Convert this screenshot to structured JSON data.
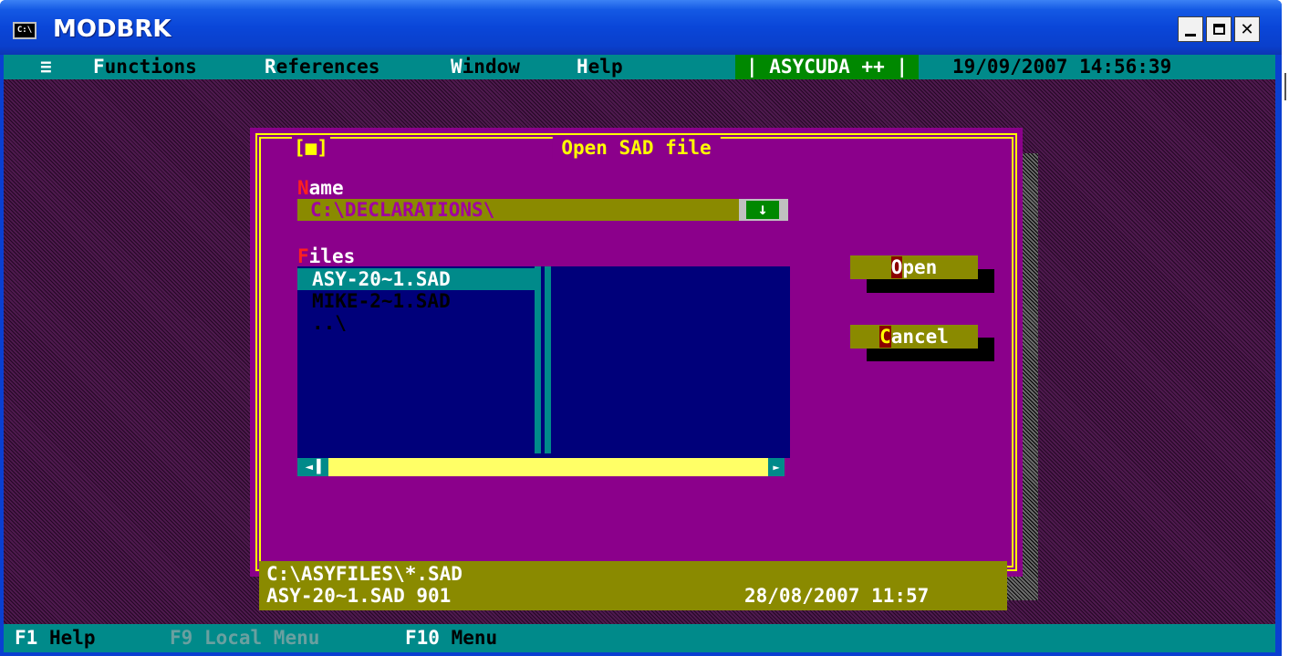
{
  "window": {
    "title": "MODBRK",
    "icon_text": "C:\\",
    "controls": {
      "minimize": "minimize-icon",
      "maximize": "maximize-icon",
      "close": "close-icon"
    },
    "close_glyph": "✕"
  },
  "menu": {
    "system": "≡",
    "items": [
      {
        "hotkey": "F",
        "rest": "unctions"
      },
      {
        "hotkey": "R",
        "rest": "eferences"
      },
      {
        "hotkey": "W",
        "rest": "indow"
      },
      {
        "hotkey": "H",
        "rest": "elp"
      }
    ],
    "badge": "| ASYCUDA ++ |",
    "clock": "19/09/2007 14:56:39"
  },
  "dialog": {
    "close_box": "[■]",
    "title": "Open SAD file",
    "name_label": {
      "hotkey": "N",
      "rest": "ame"
    },
    "name_value": "C:\\DECLARATIONS\\",
    "dropdown_glyph": "↓",
    "files_label": {
      "hotkey": "F",
      "rest": "iles"
    },
    "files": [
      "ASY-20~1.SAD",
      "MIKE-2~1.SAD",
      "..\\"
    ],
    "scroll_left": "◄▐",
    "scroll_right": "►",
    "buttons": {
      "open": {
        "hotkey": "O",
        "rest": "pen"
      },
      "cancel": {
        "hotkey": "C",
        "rest": "ancel"
      }
    },
    "status": {
      "path": "C:\\ASYFILES\\*.SAD",
      "file_info": "ASY-20~1.SAD 901",
      "datetime": "28/08/2007 11:57"
    }
  },
  "statusbar": [
    {
      "key": "F1",
      "label": "Help",
      "disabled": false
    },
    {
      "key": "F9",
      "label": "Local Menu",
      "disabled": true
    },
    {
      "key": "F10",
      "label": "Menu",
      "disabled": false
    }
  ],
  "colors": {
    "console_bg": "#3a0f3a",
    "dialog_bg": "#8b008b",
    "frame": "#ffff00",
    "menubar": "#008a8a",
    "badge": "#008800",
    "list_bg": "#00007a",
    "button_bg": "#8a8a00"
  }
}
